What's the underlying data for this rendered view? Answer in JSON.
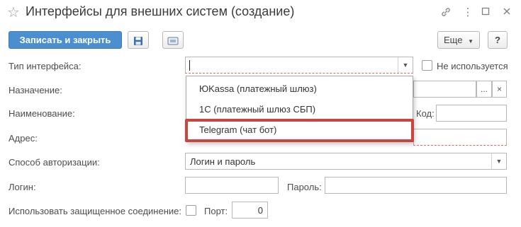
{
  "window": {
    "title": "Интерфейсы для внешних систем (создание)",
    "icons": {
      "favorite": "star-icon",
      "link": "link-icon",
      "restore": "restore-icon",
      "close": "close-icon"
    }
  },
  "toolbar": {
    "save_close_label": "Записать и закрыть",
    "more_label": "Еще",
    "help_label": "?",
    "icons": {
      "save": "floppy-disk-icon",
      "registry": "register-icon"
    },
    "colors": {
      "primary": "#4b8fd1"
    }
  },
  "form": {
    "interface_type": {
      "label": "Тип интерфейса:",
      "value": ""
    },
    "not_used": {
      "label": "Не используется"
    },
    "purpose": {
      "label": "Назначение:",
      "value": "",
      "select_label": "...",
      "clear_label": "×"
    },
    "name": {
      "label": "Наименование:",
      "value": ""
    },
    "code": {
      "label": "Код:",
      "value": ""
    },
    "address": {
      "label": "Адрес:",
      "value": ""
    },
    "auth": {
      "label": "Способ авторизации:",
      "value": "Логин и пароль"
    },
    "login": {
      "label": "Логин:",
      "value": ""
    },
    "password": {
      "label": "Пароль:",
      "value": ""
    },
    "secure": {
      "label": "Использовать защищенное соединение:"
    },
    "port": {
      "label": "Порт:",
      "value": "0"
    }
  },
  "dropdown": {
    "items": [
      {
        "label": "ЮKassa (платежный шлюз)"
      },
      {
        "label": "1С (платежный шлюз СБП)"
      },
      {
        "label": "Telegram (чат бот)"
      }
    ],
    "highlight_color": "#c94540"
  }
}
